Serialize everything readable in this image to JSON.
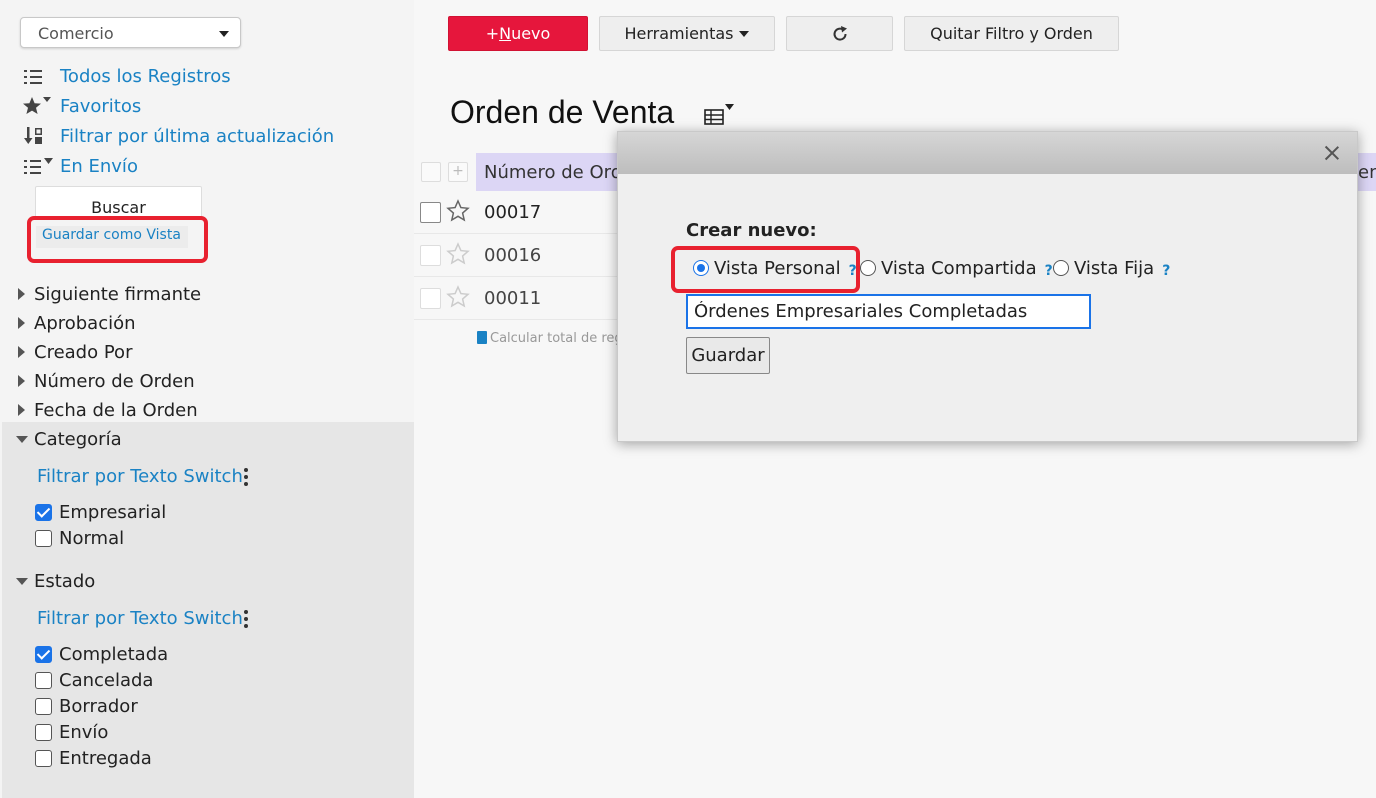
{
  "sidebar": {
    "app_select": "Comercio",
    "nav": [
      {
        "label": "Todos los Registros",
        "icon": "list-icon"
      },
      {
        "label": "Favoritos",
        "icon": "star-filter-icon"
      },
      {
        "label": "Filtrar por última actualización",
        "icon": "sort-updated-icon"
      },
      {
        "label": "En Envío",
        "icon": "list-filter-icon"
      }
    ],
    "search_label": "Buscar",
    "save_view_label": "Guardar como Vista",
    "tree": [
      {
        "label": "Siguiente firmante",
        "expanded": false
      },
      {
        "label": "Aprobación",
        "expanded": false
      },
      {
        "label": "Creado Por",
        "expanded": false
      },
      {
        "label": "Número de Orden",
        "expanded": false
      },
      {
        "label": "Fecha de la Orden",
        "expanded": false
      }
    ],
    "categoria": {
      "label": "Categoría",
      "switch_label": "Filtrar por Texto Switch",
      "options": [
        {
          "label": "Empresarial",
          "checked": true
        },
        {
          "label": "Normal",
          "checked": false
        }
      ]
    },
    "estado": {
      "label": "Estado",
      "switch_label": "Filtrar por Texto Switch",
      "options": [
        {
          "label": "Completada",
          "checked": true
        },
        {
          "label": "Cancelada",
          "checked": false
        },
        {
          "label": "Borrador",
          "checked": false
        },
        {
          "label": "Envío",
          "checked": false
        },
        {
          "label": "Entregada",
          "checked": false
        }
      ]
    }
  },
  "toolbar": {
    "new_prefix": "+",
    "new_mnemonic": "N",
    "new_rest": "uevo",
    "tools_label": "Herramientas",
    "refresh_icon": "refresh-icon",
    "clear_label": "Quitar Filtro y Orden"
  },
  "main": {
    "title": "Orden de Venta",
    "column_header": "Número de Orden",
    "column_header_right": "en",
    "rows": [
      "00017",
      "00016",
      "00011"
    ],
    "calc_total": "Calcular total de registros"
  },
  "dialog": {
    "title": "Crear nuevo:",
    "options": [
      {
        "label": "Vista Personal",
        "selected": true
      },
      {
        "label": "Vista Compartida",
        "selected": false
      },
      {
        "label": "Vista Fija",
        "selected": false
      }
    ],
    "help": "?",
    "input_value": "Órdenes Empresariales Completadas",
    "save_label": "Guardar"
  },
  "colors": {
    "accent": "#1a82c4",
    "primary_button": "#e6163c",
    "highlight": "#e8212f",
    "header_bg": "#dcd6f5",
    "checkbox": "#1a73e8"
  }
}
